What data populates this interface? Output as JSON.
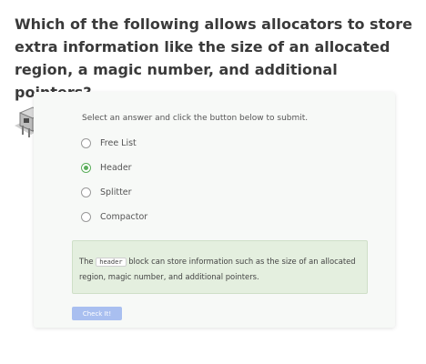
{
  "question": {
    "text": "Which of the following allows allocators to store extra information like the size of an allocated region, a magic number, and additional pointers?"
  },
  "quiz": {
    "prompt": "Select an answer and click the button below to submit.",
    "options": [
      {
        "label": "Free List",
        "selected": false
      },
      {
        "label": "Header",
        "selected": true
      },
      {
        "label": "Splitter",
        "selected": false
      },
      {
        "label": "Compactor",
        "selected": false
      }
    ],
    "feedback": {
      "before": "The ",
      "code": "header",
      "after": " block can store information such as the size of an allocated region, magic number, and additional pointers."
    },
    "submit_label": "Check It!"
  },
  "colors": {
    "accent": "#5cae5c",
    "feedback_bg": "#e4efdf",
    "button_bg": "#a9bff0"
  },
  "icons": {
    "mascot": "robot-mascot-icon"
  }
}
